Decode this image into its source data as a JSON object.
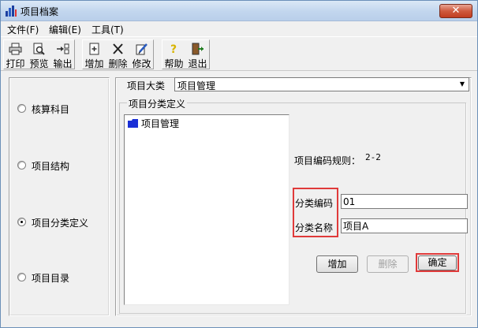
{
  "window": {
    "title": "项目档案",
    "close_label": "✕"
  },
  "menu": [
    {
      "label": "文件(F)"
    },
    {
      "label": "编辑(E)"
    },
    {
      "label": "工具(T)"
    }
  ],
  "toolbar": {
    "print": "打印",
    "preview": "预览",
    "export": "输出",
    "add": "增加",
    "delete": "删除",
    "modify": "修改",
    "help": "帮助",
    "exit": "退出"
  },
  "left_options": [
    {
      "label": "核算科目",
      "checked": false
    },
    {
      "label": "项目结构",
      "checked": false
    },
    {
      "label": "项目分类定义",
      "checked": true
    },
    {
      "label": "项目目录",
      "checked": false
    }
  ],
  "category": {
    "label": "项目大类",
    "value": "项目管理"
  },
  "group": {
    "title": "项目分类定义"
  },
  "tree": {
    "root": "项目管理"
  },
  "rule": {
    "label": "项目编码规则：",
    "value": "2-2"
  },
  "fields": {
    "code_label": "分类编码",
    "code_value": "01",
    "name_label": "分类名称",
    "name_value": "项目A"
  },
  "buttons": {
    "add": "增加",
    "delete": "删除",
    "ok": "确定"
  },
  "colors": {
    "highlight": "#e03a3a",
    "folder": "#1a2fd6"
  }
}
